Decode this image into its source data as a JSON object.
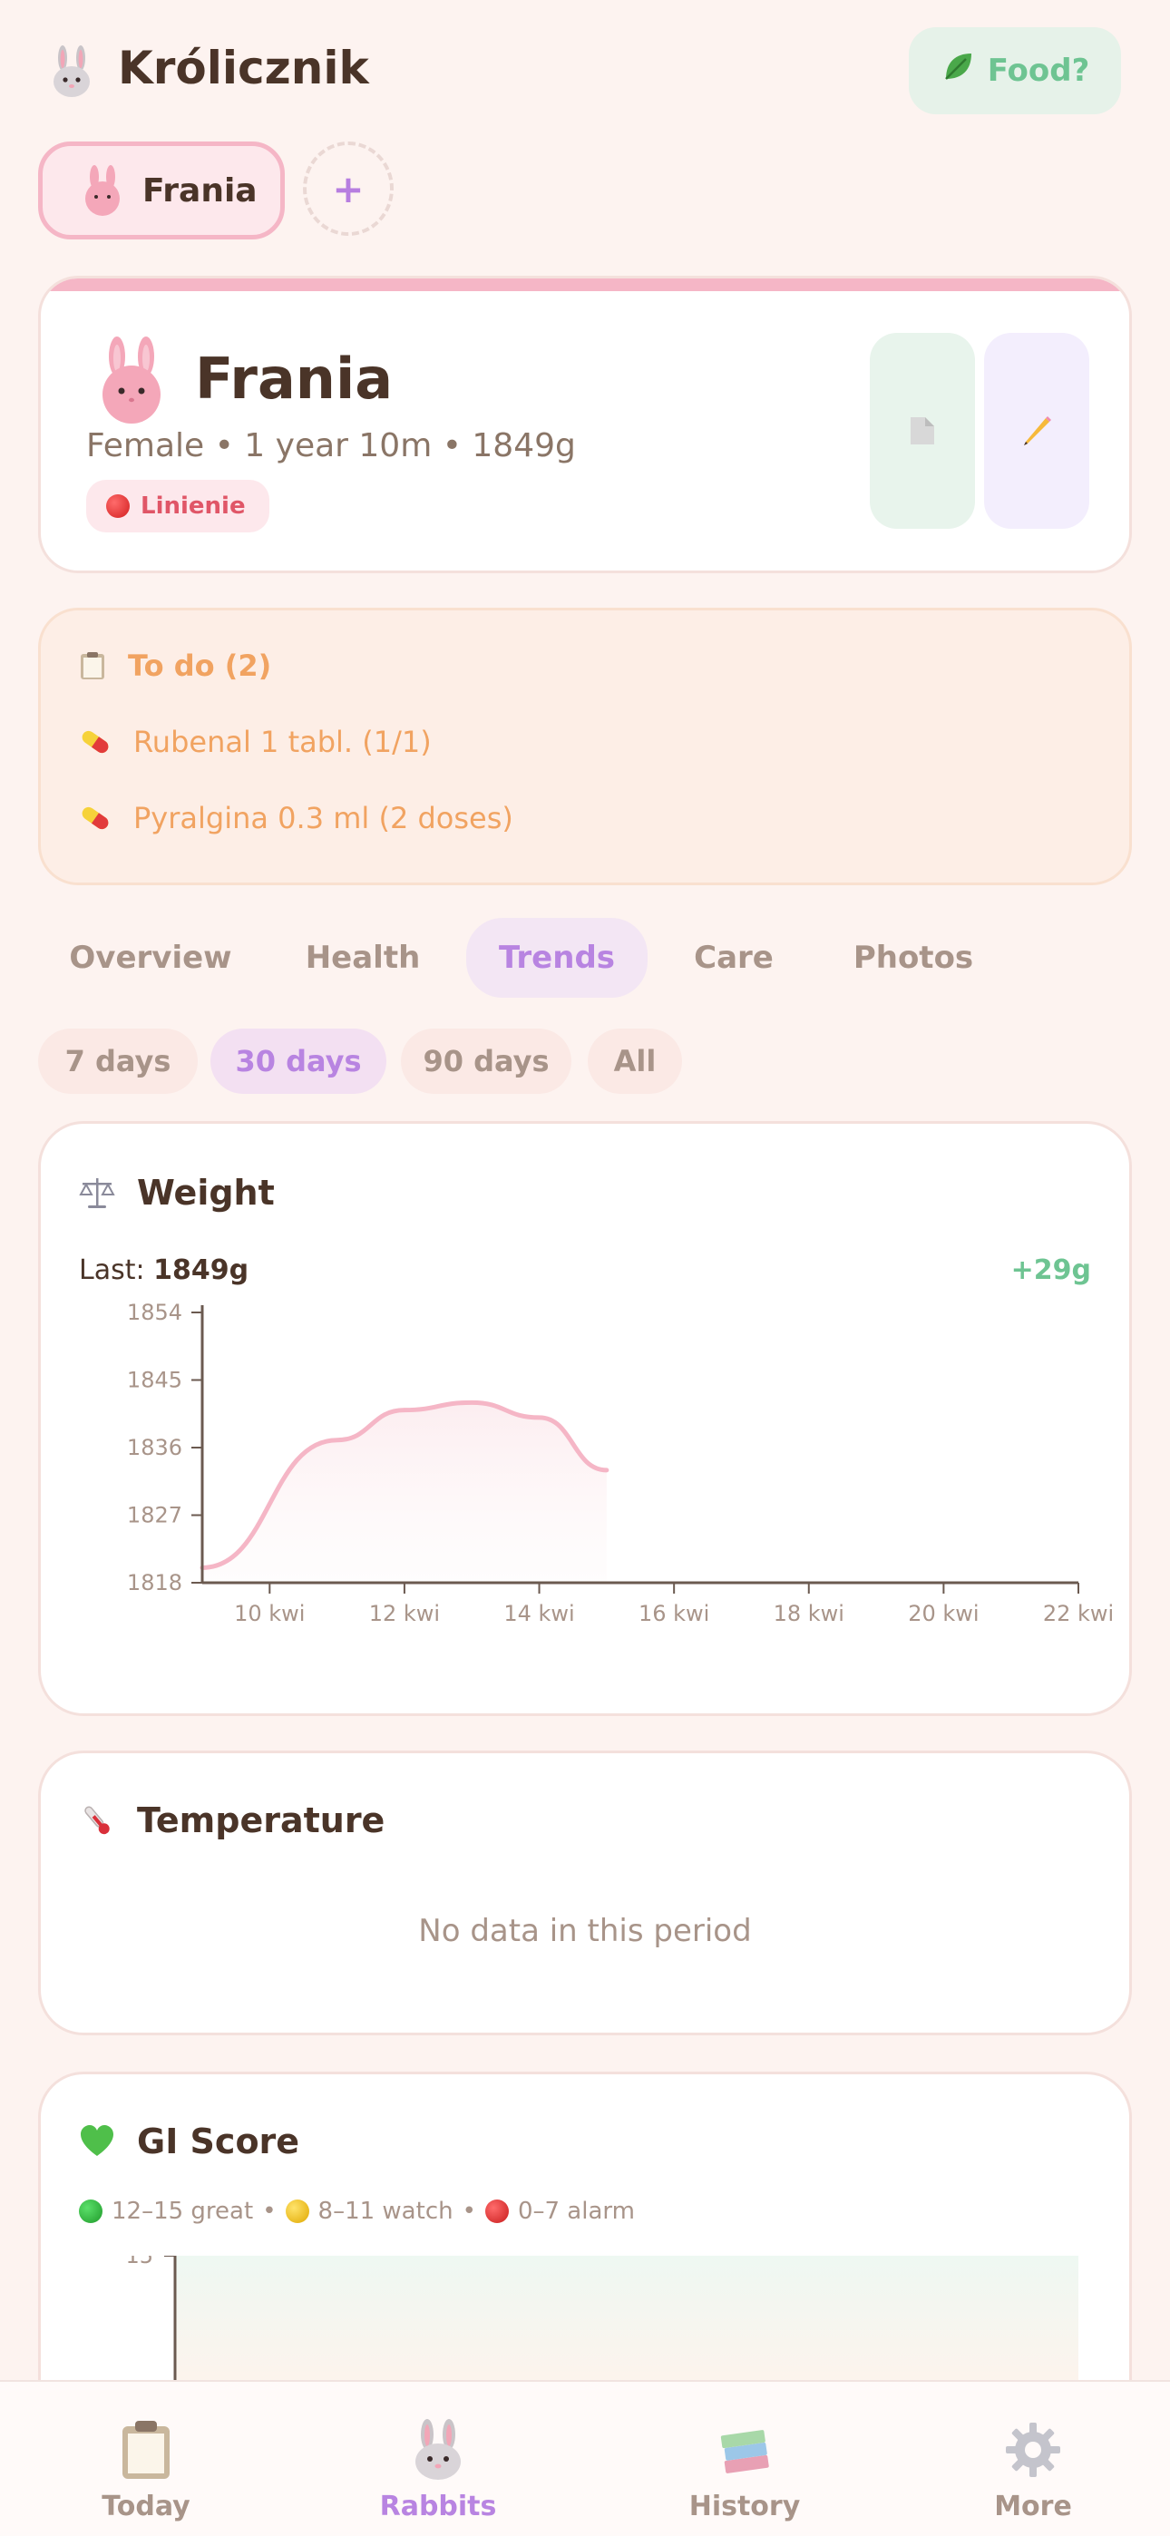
{
  "header": {
    "app_title": "Królicznik",
    "logo_icon": "rabbit-face-icon",
    "food_button_label": "Food?",
    "food_icon": "leafy-green-icon"
  },
  "rabbit_chips": [
    {
      "name": "Frania",
      "icon": "pink-rabbit-icon",
      "active": true
    }
  ],
  "add_rabbit_label": "+",
  "profile": {
    "name": "Frania",
    "meta": "Female • 1 year 10m • 1849g",
    "status": "Linienie",
    "status_icon": "red-circle-icon",
    "accent_color": "#f5b6c6"
  },
  "todo": {
    "title": "To do (2)",
    "items": [
      {
        "icon": "pill-icon",
        "text": "Rubenal 1 tabl. (1/1)"
      },
      {
        "icon": "pill-icon",
        "text": "Pyralgina 0.3 ml (2 doses)"
      }
    ]
  },
  "tabs": [
    {
      "label": "Overview",
      "active": false
    },
    {
      "label": "Health",
      "active": false
    },
    {
      "label": "Trends",
      "active": true
    },
    {
      "label": "Care",
      "active": false
    },
    {
      "label": "Photos",
      "active": false
    }
  ],
  "periods": [
    {
      "label": "7 days",
      "active": false
    },
    {
      "label": "30 days",
      "active": true
    },
    {
      "label": "90 days",
      "active": false
    },
    {
      "label": "All",
      "active": false
    }
  ],
  "weight": {
    "title": "Weight",
    "icon": "balance-scale-icon",
    "last_label": "Last:",
    "last_value": "1849g",
    "delta": "+29g"
  },
  "temperature": {
    "title": "Temperature",
    "icon": "thermometer-icon",
    "empty": "No data in this period"
  },
  "gi_score": {
    "title": "GI Score",
    "icon": "green-heart-icon",
    "legend": [
      {
        "color": "#2dbb3a",
        "text": "12–15 great"
      },
      {
        "color": "#f6c623",
        "text": "8–11 watch"
      },
      {
        "color": "#e0262d",
        "text": "0–7 alarm"
      }
    ],
    "y_top_label": "15"
  },
  "chart_data": [
    {
      "type": "line",
      "title": "Weight",
      "xlabel": "",
      "ylabel": "",
      "x_ticks": [
        "10 kwi",
        "12 kwi",
        "14 kwi",
        "16 kwi",
        "18 kwi",
        "20 kwi",
        "22 kwi"
      ],
      "y_ticks": [
        1818,
        1827,
        1836,
        1845,
        1854
      ],
      "ylim": [
        1818,
        1854
      ],
      "x_range_days": [
        9,
        22
      ],
      "series": [
        {
          "color": "#f5b6c6",
          "points": [
            {
              "x": "9 kwi",
              "y": 1820
            },
            {
              "x": "11 kwi",
              "y": 1837
            },
            {
              "x": "12 kwi",
              "y": 1841
            },
            {
              "x": "13 kwi",
              "y": 1842
            },
            {
              "x": "14 kwi",
              "y": 1840
            },
            {
              "x": "15 kwi",
              "y": 1833
            }
          ]
        }
      ],
      "grid": false
    }
  ],
  "bottom_nav": [
    {
      "label": "Today",
      "icon": "clipboard-icon",
      "active": false
    },
    {
      "label": "Rabbits",
      "icon": "rabbit-face-icon",
      "active": true
    },
    {
      "label": "History",
      "icon": "books-icon",
      "active": false
    },
    {
      "label": "More",
      "icon": "gear-icon",
      "active": false
    }
  ]
}
